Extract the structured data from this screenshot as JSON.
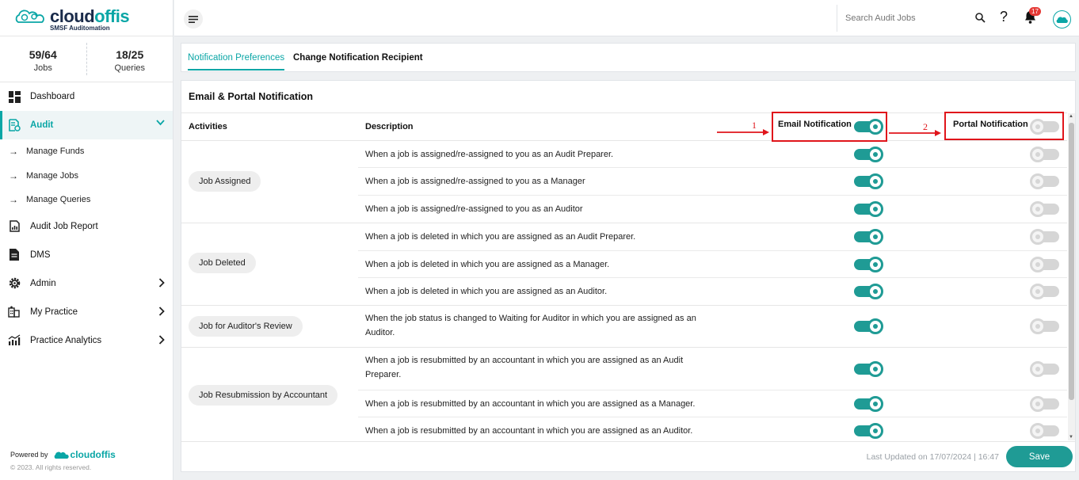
{
  "brand": {
    "name_dark": "cloud",
    "name_accent": "offis",
    "tagline": "SMSF Auditomation"
  },
  "stats": [
    {
      "value": "59/64",
      "label": "Jobs"
    },
    {
      "value": "18/25",
      "label": "Queries"
    }
  ],
  "nav": {
    "dashboard": "Dashboard",
    "audit": "Audit",
    "manage_funds": "Manage Funds",
    "manage_jobs": "Manage Jobs",
    "manage_queries": "Manage Queries",
    "audit_job_report": "Audit Job Report",
    "dms": "DMS",
    "admin": "Admin",
    "my_practice": "My Practice",
    "practice_analytics": "Practice Analytics"
  },
  "footer_sidebar": {
    "powered_by": "Powered by",
    "brand": "cloudoffis",
    "copyright": "© 2023. All rights reserved."
  },
  "header": {
    "search_placeholder": "Search Audit Jobs",
    "help": "?",
    "notification_count": "17"
  },
  "tabs": {
    "preferences": "Notification Preferences",
    "recipient": "Change Notification Recipient"
  },
  "card": {
    "title": "Email & Portal Notification",
    "col_activities": "Activities",
    "col_description": "Description",
    "col_email": "Email Notification",
    "col_portal": "Portal Notification",
    "email_all": true,
    "portal_all": false
  },
  "annotations": {
    "one": "1",
    "two": "2"
  },
  "groups": [
    {
      "activity": "Job Assigned",
      "rows": [
        {
          "description": "When a job is assigned/re-assigned to you as an Audit Preparer.",
          "email": true,
          "portal": false
        },
        {
          "description": "When a job is assigned/re-assigned to you as a Manager",
          "email": true,
          "portal": false
        },
        {
          "description": "When a job is assigned/re-assigned to you as an Auditor",
          "email": true,
          "portal": false
        }
      ]
    },
    {
      "activity": "Job Deleted",
      "rows": [
        {
          "description": "When a job is deleted in which you are assigned as an Audit Preparer.",
          "email": true,
          "portal": false
        },
        {
          "description": "When a job is deleted in which you are assigned as a Manager.",
          "email": true,
          "portal": false
        },
        {
          "description": "When a job is deleted in which you are assigned as an Auditor.",
          "email": true,
          "portal": false
        }
      ]
    },
    {
      "activity": "Job for Auditor's Review",
      "rows": [
        {
          "description": "When the job status is changed to Waiting for Auditor in which you are assigned as an Auditor.",
          "email": true,
          "portal": false
        }
      ]
    },
    {
      "activity": "Job Resubmission by Accountant",
      "rows": [
        {
          "description": "When a job is resubmitted by an accountant in which you are assigned as an Audit Preparer.",
          "email": true,
          "portal": false
        },
        {
          "description": "When a job is resubmitted by an accountant in which you are assigned as a Manager.",
          "email": true,
          "portal": false
        },
        {
          "description": "When a job is resubmitted by an accountant in which you are assigned as an Auditor.",
          "email": true,
          "portal": false
        }
      ]
    }
  ],
  "footer": {
    "last_updated": "Last Updated on 17/07/2024 | 16:47",
    "save": "Save"
  },
  "colors": {
    "accent": "#0aa6a6",
    "toggle_on": "#1f9b95",
    "annotation": "#e0151b"
  }
}
